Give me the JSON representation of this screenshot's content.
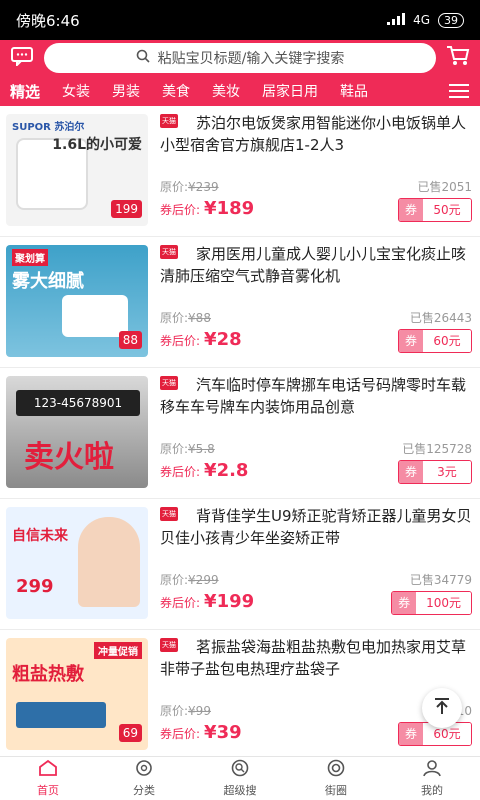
{
  "status": {
    "time": "傍晚6:46",
    "network": "4G",
    "battery": "39"
  },
  "search": {
    "placeholder": "粘贴宝贝标题/输入关键字搜索"
  },
  "icons": {
    "message": "message-icon",
    "search": "search-icon",
    "cart": "cart-icon",
    "menu": "menu-icon",
    "tmall": "tmall-icon"
  },
  "colors": {
    "brand": "#ef2b57",
    "statusbar": "#000000"
  },
  "tabs": [
    {
      "label": "精选"
    },
    {
      "label": "女装"
    },
    {
      "label": "男装"
    },
    {
      "label": "美食"
    },
    {
      "label": "美妆"
    },
    {
      "label": "居家日用"
    },
    {
      "label": "鞋品"
    }
  ],
  "products": [
    {
      "title": "苏泊尔电饭煲家用智能迷你小电饭锅单人小型宿舍官方旗舰店1-2人3",
      "orig_label": "原价:",
      "orig": "¥239",
      "sold": "已售2051",
      "final_label": "券后价:",
      "final": "¥189",
      "coupon_label": "券",
      "coupon": "50元",
      "thumb": {
        "cap": "SUPOR 苏泊尔",
        "big": "1.6L的小可爱",
        "price": "199",
        "bg": "#f1f1f1",
        "fg": "#333"
      }
    },
    {
      "title": "家用医用儿童成人婴儿小儿宝宝化痰止咳清肺压缩空气式静音雾化机",
      "orig_label": "原价:",
      "orig": "¥88",
      "sold": "已售26443",
      "final_label": "券后价:",
      "final": "¥28",
      "coupon_label": "券",
      "coupon": "60元",
      "thumb": {
        "cap": "聚划算",
        "big": "雾大细腻",
        "price": "88",
        "bg": "#3ea1c9",
        "fg": "#fff"
      }
    },
    {
      "title": "汽车临时停车牌挪车电话号码牌零时车载移车车号牌车内装饰用品创意",
      "orig_label": "原价:",
      "orig": "¥5.8",
      "sold": "已售125728",
      "final_label": "券后价:",
      "final": "¥2.8",
      "coupon_label": "券",
      "coupon": "3元",
      "thumb": {
        "cap": "123-45678901",
        "big": "卖火啦",
        "price": "",
        "bg": "#b9b9b9",
        "fg": "#e21f3c"
      }
    },
    {
      "title": "背背佳学生U9矫正驼背矫正器儿童男女贝贝佳小孩青少年坐姿矫正带",
      "orig_label": "原价:",
      "orig": "¥299",
      "sold": "已售34779",
      "final_label": "券后价:",
      "final": "¥199",
      "coupon_label": "券",
      "coupon": "100元",
      "thumb": {
        "cap": "自信未来",
        "big": "299",
        "price": "",
        "bg": "#eaf3ff",
        "fg": "#e21f3c"
      }
    },
    {
      "title": "茗振盐袋海盐粗盐热敷包电加热家用艾草非带子盐包电热理疗盐袋子",
      "orig_label": "原价:",
      "orig": "¥99",
      "sold": "已售10",
      "final_label": "券后价:",
      "final": "¥39",
      "coupon_label": "券",
      "coupon": "60元",
      "thumb": {
        "cap": "冲量促销",
        "big": "粗盐热敷",
        "price": "69",
        "bg": "#ffe6c7",
        "fg": "#e21f3c"
      }
    }
  ],
  "bottom_nav": [
    {
      "label": "首页",
      "icon": "home-icon"
    },
    {
      "label": "分类",
      "icon": "category-icon"
    },
    {
      "label": "超级搜",
      "icon": "super-search-icon"
    },
    {
      "label": "街圈",
      "icon": "street-icon"
    },
    {
      "label": "我的",
      "icon": "profile-icon"
    }
  ]
}
